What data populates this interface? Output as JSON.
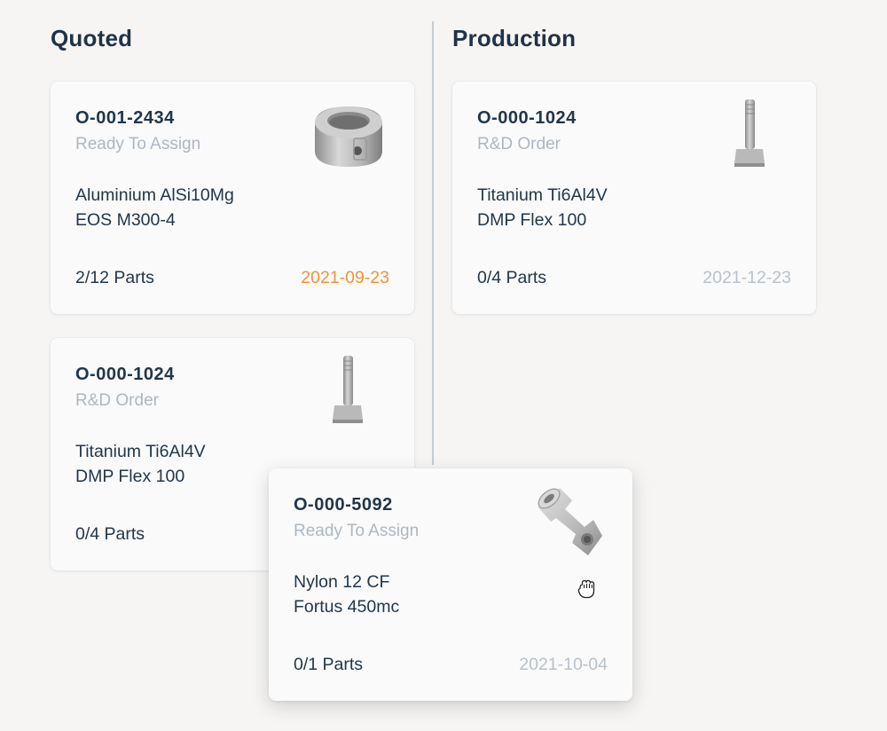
{
  "columns": {
    "quoted": {
      "title": "Quoted"
    },
    "production": {
      "title": "Production"
    }
  },
  "cards": {
    "quoted_1": {
      "id": "O-001-2434",
      "status": "Ready To Assign",
      "material": "Aluminium AlSi10Mg",
      "machine": "EOS M300-4",
      "parts": "2/12 Parts",
      "date": "2021-09-23",
      "date_color": "#ef9436",
      "thumbnail_icon": "ring-part-icon"
    },
    "quoted_2": {
      "id": "O-000-1024",
      "status": "R&D Order",
      "material": "Titanium Ti6Al4V",
      "machine": "DMP Flex 100",
      "parts": "0/4 Parts",
      "thumbnail_icon": "bolt-part-icon"
    },
    "production_1": {
      "id": "O-000-1024",
      "status": "R&D Order",
      "material": "Titanium Ti6Al4V",
      "machine": "DMP Flex 100",
      "parts": "0/4 Parts",
      "date": "2021-12-23",
      "date_color": "#b8c1ca",
      "thumbnail_icon": "bolt-part-icon"
    },
    "dragging": {
      "id": "O-000-5092",
      "status": "Ready To Assign",
      "material": "Nylon 12 CF",
      "machine": "Fortus 450mc",
      "parts": "0/1 Parts",
      "date": "2021-10-04",
      "date_color": "#b8c1ca",
      "thumbnail_icon": "elbow-fitting-part-icon"
    }
  },
  "cursor": {
    "icon": "grab-hand-icon"
  }
}
